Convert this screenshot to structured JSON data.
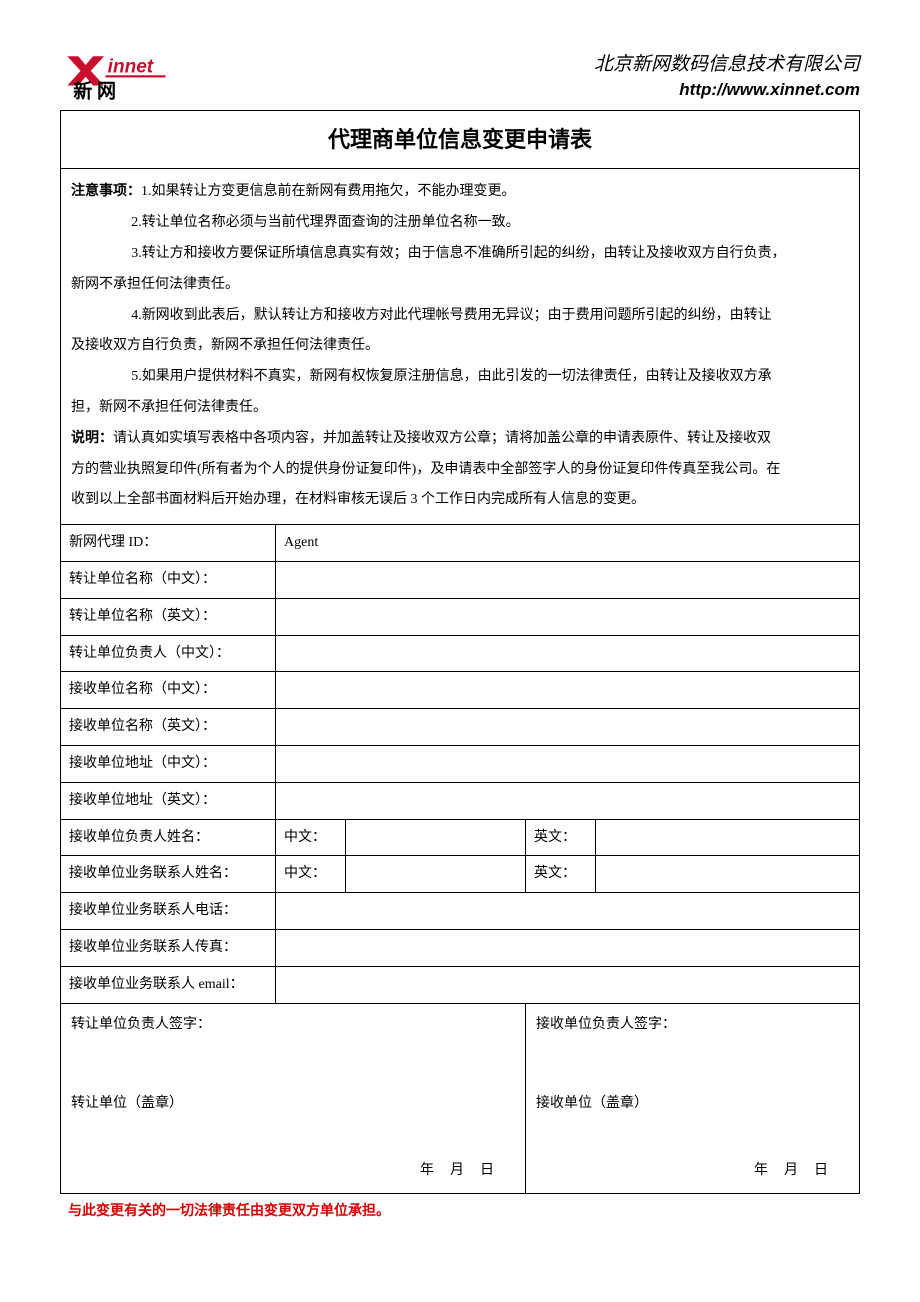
{
  "header": {
    "logo_text_top": "Xinnet",
    "logo_text_bottom": "新 网",
    "company_name": "北京新网数码信息技术有限公司",
    "company_url": "http://www.xinnet.com"
  },
  "title": "代理商单位信息变更申请表",
  "notice": {
    "label": "注意事项：",
    "item1": "1.如果转让方变更信息前在新网有费用拖欠，不能办理变更。",
    "item2": "2.转让单位名称必须与当前代理界面查询的注册单位名称一致。",
    "item3a": "3.转让方和接收方要保证所填信息真实有效；由于信息不准确所引起的纠纷，由转让及接收双方自行负责，",
    "item3b": "新网不承担任何法律责任。",
    "item4a": "4.新网收到此表后，默认转让方和接收方对此代理帐号费用无异议；由于费用问题所引起的纠纷，由转让",
    "item4b": "及接收双方自行负责，新网不承担任何法律责任。",
    "item5a": "5.如果用户提供材料不真实，新网有权恢复原注册信息，由此引发的一切法律责任，由转让及接收双方承",
    "item5b": "担，新网不承担任何法律责任。"
  },
  "explain": {
    "label": "说明：",
    "line1": "请认真如实填写表格中各项内容，并加盖转让及接收双方公章；请将加盖公章的申请表原件、转让及接收双",
    "line2": "方的营业执照复印件(所有者为个人的提供身份证复印件)，及申请表中全部签字人的身份证复印件传真至我公司。在",
    "line3": "收到以上全部书面材料后开始办理，在材料审核无误后 3 个工作日内完成所有人信息的变更。"
  },
  "rows": {
    "agent_id_label": "新网代理 ID：",
    "agent_id_value": "Agent",
    "transfer_name_cn": "转让单位名称（中文）：",
    "transfer_name_en": "转让单位名称（英文）：",
    "transfer_manager_cn": "转让单位负责人（中文）：",
    "recv_name_cn": "接收单位名称（中文）：",
    "recv_name_en": "接收单位名称（英文）：",
    "recv_addr_cn": "接收单位地址（中文）：",
    "recv_addr_en": "接收单位地址（英文）：",
    "recv_manager_name": "接收单位负责人姓名：",
    "recv_contact_name": "接收单位业务联系人姓名：",
    "recv_contact_phone": "接收单位业务联系人电话：",
    "recv_contact_fax": "接收单位业务联系人传真：",
    "recv_contact_email": "接收单位业务联系人 email：",
    "cn_sub": "中文：",
    "en_sub": "英文："
  },
  "sig": {
    "left_sign": "转让单位负责人签字：",
    "left_seal": "转让单位（盖章）",
    "right_sign": "接收单位负责人签字：",
    "right_seal": "接收单位（盖章）",
    "date_fmt": "年 月 日"
  },
  "footer": "与此变更有关的一切法律责任由变更双方单位承担。"
}
